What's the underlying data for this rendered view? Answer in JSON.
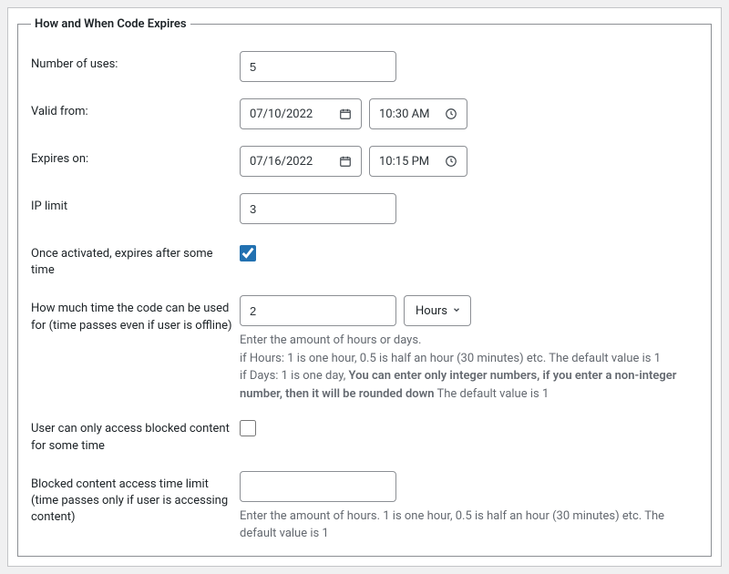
{
  "legend": "How and When Code Expires",
  "numberOfUses": {
    "label": "Number of uses:",
    "value": "5"
  },
  "validFrom": {
    "label": "Valid from:",
    "date": "07/10/2022",
    "time": "10:30 AM"
  },
  "expiresOn": {
    "label": "Expires on:",
    "date": "07/16/2022",
    "time": "10:15 PM"
  },
  "ipLimit": {
    "label": "IP limit",
    "value": "3"
  },
  "onceActivated": {
    "label": "Once activated, expires after some time",
    "checked": true
  },
  "timeUsed": {
    "label": "How much time the code can be used for (time passes even if user is offline)",
    "value": "2",
    "unit": "Hours",
    "desc1": "Enter the amount of hours or days.",
    "desc2a": "if Hours: 1 is one hour, 0.5 is half an hour (30 minutes) etc. The default value is 1",
    "desc3a": "if Days: 1 is one day, ",
    "desc3b": "You can enter only integer numbers, if you enter a non-integer number, then it will be rounded down",
    "desc3c": " The default value is 1"
  },
  "onlyBlocked": {
    "label": "User can only access blocked content for some time",
    "checked": false
  },
  "blockedLimit": {
    "label": "Blocked content access time limit (time passes only if user is accessing content)",
    "value": "",
    "desc": "Enter the amount of hours. 1 is one hour, 0.5 is half an hour (30 minutes) etc. The default value is 1"
  }
}
